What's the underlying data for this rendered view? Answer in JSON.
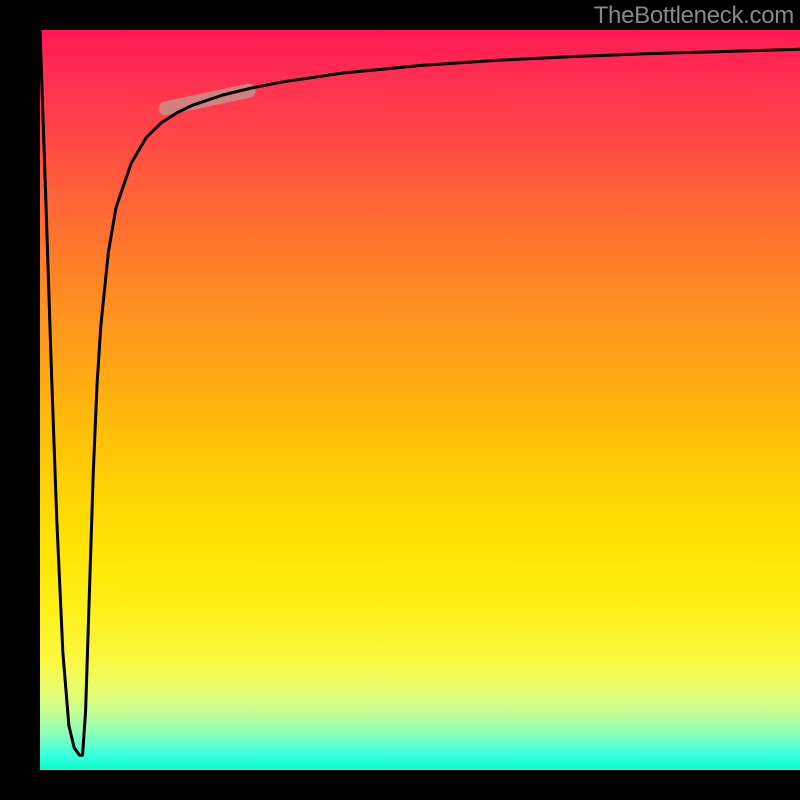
{
  "watermark": "TheBottleneck.com",
  "chart_data": {
    "type": "line",
    "title": "",
    "xlabel": "",
    "ylabel": "",
    "xlim": [
      0,
      100
    ],
    "ylim": [
      0,
      100
    ],
    "grid": false,
    "legend": false,
    "background_gradient": {
      "direction": "vertical",
      "stops": [
        {
          "pos": 0,
          "color": "#ff1752"
        },
        {
          "pos": 50,
          "color": "#ffb010"
        },
        {
          "pos": 80,
          "color": "#fff018"
        },
        {
          "pos": 100,
          "color": "#08ffc7"
        }
      ]
    },
    "series": [
      {
        "name": "bottleneck-curve",
        "style": "solid-black",
        "x": [
          0.0,
          0.8,
          1.5,
          2.2,
          3.0,
          3.8,
          4.5,
          5.2,
          5.6,
          6.0,
          6.5,
          7.0,
          7.5,
          8.0,
          9.0,
          10.0,
          12.0,
          14.0,
          16.0,
          18.0,
          20.0,
          24.0,
          28.0,
          32.0,
          40.0,
          50.0,
          60.0,
          70.0,
          80.0,
          90.0,
          100.0
        ],
        "y": [
          100.0,
          76.0,
          54.0,
          34.0,
          16.0,
          6.0,
          3.0,
          2.0,
          2.0,
          8.0,
          24.0,
          40.0,
          52.0,
          60.0,
          70.0,
          76.0,
          82.0,
          85.5,
          87.5,
          88.8,
          89.8,
          91.2,
          92.2,
          93.0,
          94.2,
          95.2,
          95.9,
          96.4,
          96.8,
          97.1,
          97.4
        ]
      }
    ],
    "highlight_segment": {
      "center_x": 22.0,
      "center_y": 90.6,
      "angle_deg": -12,
      "length": 13.0,
      "color": "#c88f89"
    }
  }
}
